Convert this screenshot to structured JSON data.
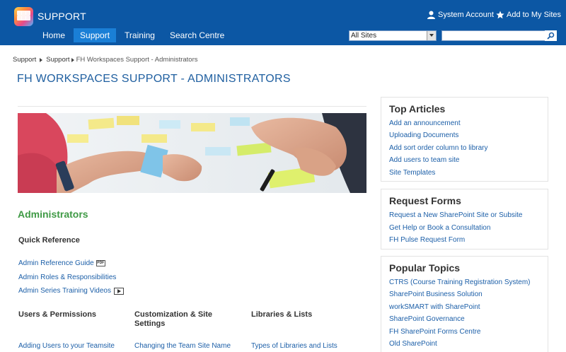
{
  "header": {
    "site_name": "SUPPORT",
    "account_label": "System Account",
    "add_sites_label": "Add to My Sites",
    "nav": [
      {
        "label": "Home"
      },
      {
        "label": "Support",
        "active": true
      },
      {
        "label": "Training"
      },
      {
        "label": "Search Centre"
      }
    ],
    "search_scope": "All Sites",
    "search_placeholder": ""
  },
  "breadcrumb": {
    "items": [
      "Support",
      "Support"
    ],
    "current": "FH Workspaces Support - Administrators"
  },
  "page": {
    "title": "FH WORKSPACES SUPPORT - ADMINISTRATORS",
    "section_heading": "Administrators",
    "quick_reference": {
      "heading": "Quick Reference",
      "links": [
        {
          "label": "Admin Reference Guide",
          "icon": "pdf-icon",
          "icon_text": "PDF"
        },
        {
          "label": "Admin Roles & Responsibilities"
        },
        {
          "label": "Admin Series Training Videos",
          "icon": "video-icon"
        }
      ]
    },
    "columns": [
      {
        "heading": "Users & Permissions",
        "first_link": "Adding Users to your Teamsite"
      },
      {
        "heading": "Customization & Site Settings",
        "first_link": "Changing the Team Site Name"
      },
      {
        "heading": "Libraries & Lists",
        "first_link": "Types of Libraries and Lists"
      }
    ]
  },
  "sidebar": {
    "top_articles": {
      "title": "Top Articles",
      "links": [
        "Add an announcement",
        "Uploading Documents",
        "Add sort order column to library",
        "Add users to team site",
        "Site Templates"
      ]
    },
    "request_forms": {
      "title": "Request Forms",
      "links": [
        "Request a New SharePoint Site or Subsite",
        "Get Help or Book a Consultation",
        "FH Pulse Request Form"
      ]
    },
    "popular_topics": {
      "title": "Popular Topics",
      "links": [
        "CTRS (Course Training Registration System)",
        "SharePoint Business Solution",
        "workSMART with SharePoint",
        "SharePoint Governance",
        "FH SharePoint Forms Centre",
        "Old SharePoint"
      ]
    }
  },
  "colors": {
    "header_bg": "#0c57a4",
    "nav_active_bg": "#1a7fd6",
    "title_blue": "#1f5fa0",
    "link_blue": "#1c5fa8",
    "section_green": "#3f9a45"
  }
}
